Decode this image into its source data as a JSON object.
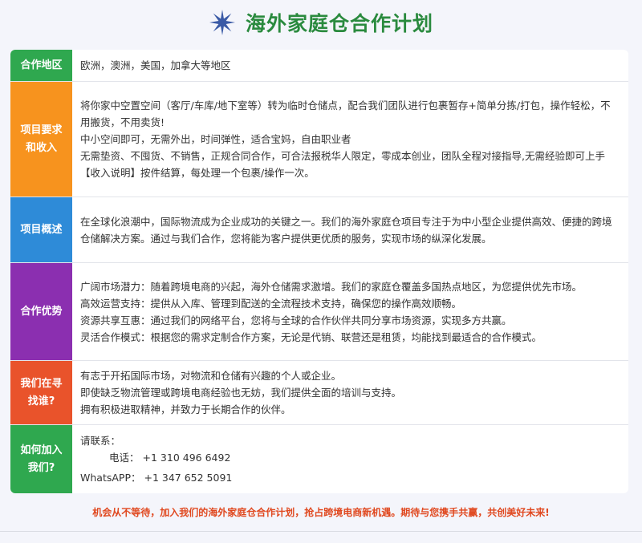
{
  "header": {
    "title": "海外家庭仓合作计划",
    "logo_icon": "star-burst-icon",
    "logo_color": "#3a5aa6",
    "title_color": "#2a8a3e"
  },
  "sections": [
    {
      "id": "region",
      "label": [
        "合作地区"
      ],
      "color": "#2fa84f",
      "lines": [
        "欧洲，澳洲，美国，加拿大等地区"
      ]
    },
    {
      "id": "requirements",
      "label": [
        "项目要求",
        "和收入"
      ],
      "color": "#f7931e",
      "lines": [
        "将你家中空置空间（客厅/车库/地下室等）转为临时仓储点，配合我们团队进行包裹暂存+简单分拣/打包，操作轻松，不用搬货，不用卖货!",
        "中小空间即可，无需外出，时间弹性，适合宝妈，自由职业者",
        "无需垫资、不囤货、不销售，正规合同合作，可合法报税华人限定，零成本创业，团队全程对接指导,无需经验即可上手",
        "【收入说明】按件结算，每处理一个包裹/操作一次。"
      ]
    },
    {
      "id": "overview",
      "label": [
        "项目概述"
      ],
      "color": "#2e8bd8",
      "lines": [
        "在全球化浪潮中，国际物流成为企业成功的关键之一。我们的海外家庭仓项目专注于为中小型企业提供高效、便捷的跨境仓储解决方案。通过与我们合作，您将能为客户提供更优质的服务，实现市场的纵深化发展。"
      ]
    },
    {
      "id": "advantages",
      "label": [
        "合作优势"
      ],
      "color": "#8b2fb0",
      "lines": [
        "广阔市场潜力：随着跨境电商的兴起，海外仓储需求激增。我们的家庭仓覆盖多国热点地区，为您提供优先市场。",
        "高效运营支持：提供从入库、管理到配送的全流程技术支持，确保您的操作高效顺畅。",
        "资源共享互惠：通过我们的网络平台，您将与全球的合作伙伴共同分享市场资源，实现多方共赢。",
        "灵活合作模式：根据您的需求定制合作方案，无论是代销、联营还是租赁，均能找到最适合的合作模式。"
      ]
    },
    {
      "id": "seeking",
      "label": [
        "我们在寻",
        "找谁?"
      ],
      "color": "#e9532b",
      "lines": [
        "有志于开拓国际市场，对物流和仓储有兴趣的个人或企业。",
        "即使缺乏物流管理或跨境电商经验也无妨，我们提供全面的培训与支持。",
        "拥有积极进取精神，并致力于长期合作的伙伴。"
      ]
    },
    {
      "id": "join",
      "label": [
        "如何加入",
        "我们?"
      ],
      "color": "#2fa84f",
      "intro": "请联系：",
      "contacts": [
        {
          "key": "电话：",
          "value": "+1  310 496 6492"
        },
        {
          "key": "WhatsAPP：",
          "value": "+1  347 652 5091"
        }
      ]
    }
  ],
  "footer": {
    "text": "机会从不等待，加入我们的海外家庭仓合作计划，抢占跨境电商新机遇。期待与您携手共赢，共创美好未来!",
    "color": "#e0481f"
  }
}
